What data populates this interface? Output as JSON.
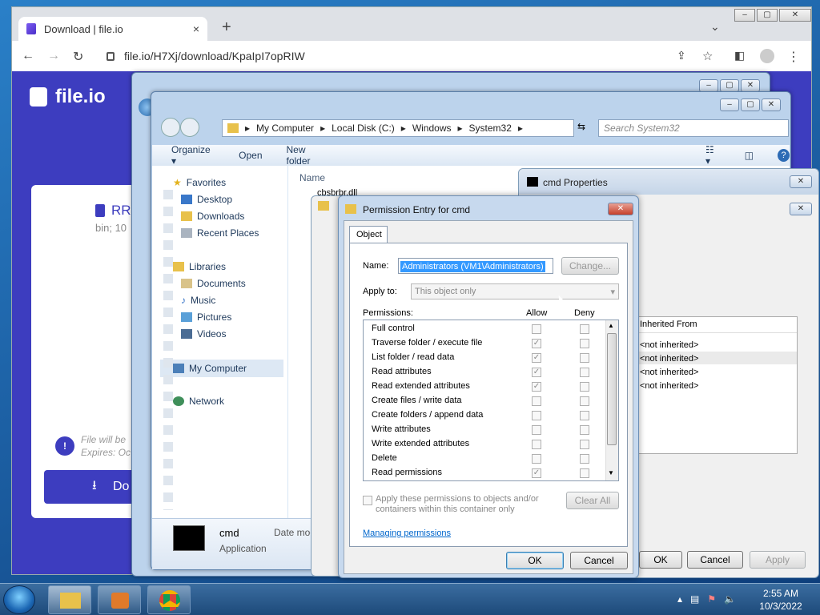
{
  "chrome": {
    "tab_title": "Download | file.io",
    "tab_close": "×",
    "new_tab": "+",
    "tab_menu": "⌄",
    "url": "file.io/H7Xj/download/KpaIpI7opRIW",
    "win_min": "–",
    "win_max": "▢",
    "win_close": "✕"
  },
  "fileio": {
    "logo_text": "file.io",
    "file_name_partial": "RR",
    "file_meta_partial": "bin; 10",
    "expire_line1": "File will be",
    "expire_line2": "Expires: Oc",
    "download_partial": "Do"
  },
  "explorer": {
    "breadcrumb": [
      "My Computer",
      "Local Disk (C:)",
      "Windows",
      "System32"
    ],
    "search_placeholder": "Search System32",
    "toolbar": {
      "organize": "Organize ▾",
      "open": "Open",
      "new_folder": "New folder"
    },
    "column_name": "Name",
    "first_file": "cbsbrbr.dll",
    "nav": {
      "favorites": "Favorites",
      "desktop": "Desktop",
      "downloads": "Downloads",
      "recent": "Recent Places",
      "libraries": "Libraries",
      "documents": "Documents",
      "music": "Music",
      "pictures": "Pictures",
      "videos": "Videos",
      "computer": "My Computer",
      "network": "Network"
    },
    "details": {
      "name": "cmd",
      "type": "Application",
      "date_label": "Date mod"
    }
  },
  "cmd_properties": {
    "title": "cmd Properties",
    "inherited_header": "Inherited From",
    "inherited_rows": [
      "<not inherited>",
      "<not inherited>",
      "<not inherited>",
      "<not inherited>"
    ],
    "ok": "OK",
    "cancel": "Cancel",
    "apply": "Apply"
  },
  "permission_entry": {
    "title": "Permission Entry for cmd",
    "tab_object": "Object",
    "name_label": "Name:",
    "name_value": "Administrators (VM1\\Administrators)",
    "change_button": "Change...",
    "apply_to_label": "Apply to:",
    "apply_to_value": "This object only",
    "permissions_label": "Permissions:",
    "allow_header": "Allow",
    "deny_header": "Deny",
    "permissions": [
      {
        "label": "Full control",
        "allow": false
      },
      {
        "label": "Traverse folder / execute file",
        "allow": true
      },
      {
        "label": "List folder / read data",
        "allow": true
      },
      {
        "label": "Read attributes",
        "allow": true
      },
      {
        "label": "Read extended attributes",
        "allow": true
      },
      {
        "label": "Create files / write data",
        "allow": false
      },
      {
        "label": "Create folders / append data",
        "allow": false
      },
      {
        "label": "Write attributes",
        "allow": false
      },
      {
        "label": "Write extended attributes",
        "allow": false
      },
      {
        "label": "Delete",
        "allow": false
      },
      {
        "label": "Read permissions",
        "allow": true
      }
    ],
    "apply_children_text_1": "Apply these permissions to objects and/or",
    "apply_children_text_2": "containers within this container only",
    "clear_all": "Clear All",
    "managing_link": "Managing permissions",
    "ok": "OK",
    "cancel": "Cancel"
  },
  "taskbar": {
    "time": "2:55 AM",
    "date": "10/3/2022"
  }
}
